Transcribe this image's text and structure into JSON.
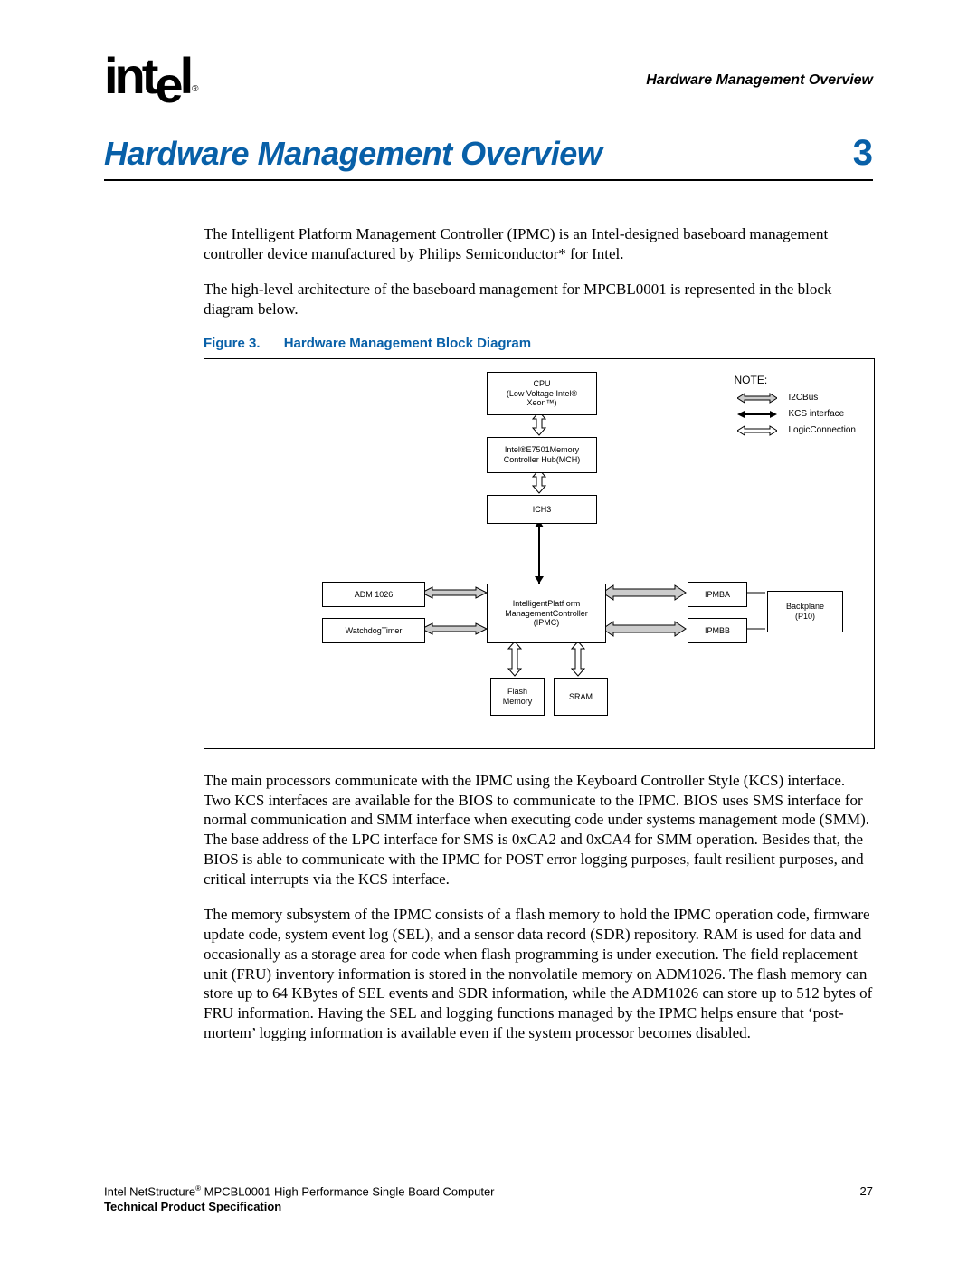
{
  "runningHead": "Hardware Management Overview",
  "chapter": {
    "title": "Hardware Management Overview",
    "num": "3"
  },
  "para1": "The Intelligent Platform Management Controller (IPMC) is an Intel-designed baseboard management controller device manufactured by Philips Semiconductor* for Intel.",
  "para2": "The high-level architecture of the baseboard management for MPCBL0001 is represented in the block diagram below.",
  "figure": {
    "num": "Figure 3.",
    "title": "Hardware Management Block Diagram"
  },
  "diagram": {
    "cpu": "CPU\n(Low Voltage Intel®\nXeon™)",
    "mch": "Intel®E7501Memory\nController Hub(MCH)",
    "ich": "ICH3",
    "adm": "ADM 1026",
    "wdt": "WatchdogTimer",
    "ipmc": "IntelligentPlatf orm\nManagementController\n(IPMC)",
    "ipmba": "IPMBA",
    "ipmbb": "IPMBB",
    "backplane": "Backplane\n(P10)",
    "flash": "Flash\nMemory",
    "sram": "SRAM",
    "legend": {
      "note": "NOTE:",
      "i2c": "I2CBus",
      "kcs": "KCS interface",
      "logic": "LogicConnection"
    }
  },
  "para3": "The main processors communicate with the IPMC using the Keyboard Controller Style (KCS) interface. Two KCS interfaces are available for the BIOS to communicate to the IPMC. BIOS uses SMS interface for normal communication and SMM interface when executing code under systems management mode (SMM). The base address of the LPC interface for SMS is 0xCA2 and 0xCA4 for SMM operation. Besides that, the BIOS is able to communicate with the IPMC for POST error logging purposes, fault resilient purposes, and critical interrupts via the KCS interface.",
  "para4": "The memory subsystem of the IPMC consists of a flash memory to hold the IPMC operation code, firmware update code, system event log (SEL), and a sensor data record (SDR) repository. RAM is used for data and occasionally as a storage area for code when flash programming is under execution. The field replacement unit (FRU) inventory information is stored in the nonvolatile memory on ADM1026. The flash memory can store up to 64 KBytes of SEL events and SDR information, while the ADM1026 can store up to 512 bytes of FRU information. Having the SEL and logging functions managed by the IPMC helps ensure that ‘post-mortem’ logging information is available even if the system processor becomes disabled.",
  "footer": {
    "line1a": "Intel NetStructure",
    "line1b": " MPCBL0001 High Performance Single Board Computer",
    "line2": "Technical Product Specification",
    "page": "27"
  }
}
